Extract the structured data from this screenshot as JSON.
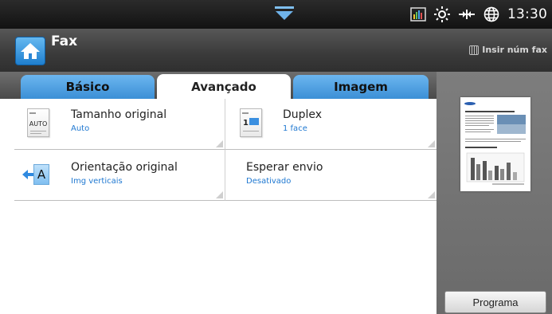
{
  "status": {
    "clock": "13:30",
    "icons": [
      "signal-bars-icon",
      "sun-icon",
      "network-icon",
      "globe-icon"
    ]
  },
  "header": {
    "title": "Fax",
    "fax_number_label": "Insir núm fax"
  },
  "tabs": [
    {
      "label": "Básico",
      "active": false
    },
    {
      "label": "Avançado",
      "active": true
    },
    {
      "label": "Imagem",
      "active": false
    }
  ],
  "options": {
    "original_size": {
      "label": "Tamanho original",
      "value": "Auto",
      "icon_text": "AUTO"
    },
    "duplex": {
      "label": "Duplex",
      "value": "1 face",
      "icon_text": "1"
    },
    "orientation": {
      "label": "Orientação original",
      "value": "Img verticais",
      "icon_text": "A"
    },
    "delay_send": {
      "label": "Esperar envio",
      "value": "Desativado"
    }
  },
  "preview": {
    "program_label": "Programa"
  },
  "colors": {
    "accent_blue": "#1f78d1",
    "tab_blue": "#4a9be0",
    "header_dark": "#3a3a3a"
  }
}
